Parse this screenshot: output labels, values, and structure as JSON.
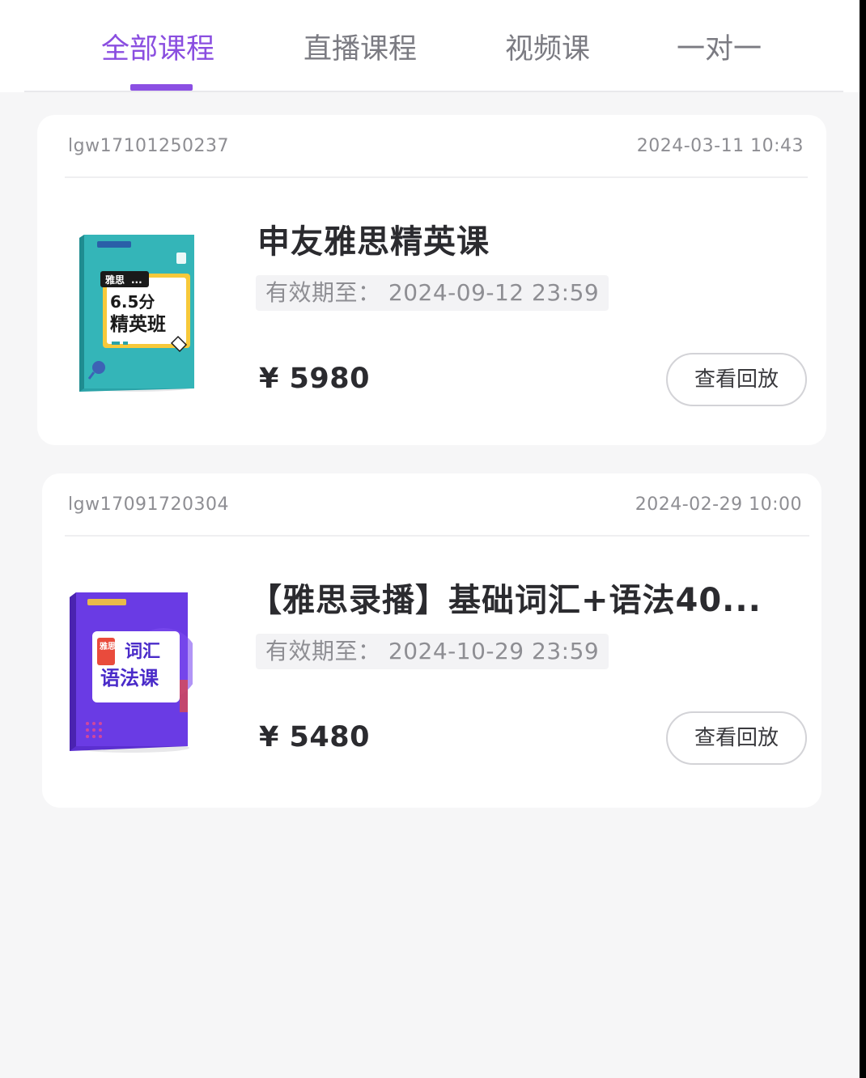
{
  "tabs": [
    {
      "label": "全部课程",
      "active": true
    },
    {
      "label": "直播课程",
      "active": false
    },
    {
      "label": "视频课",
      "active": false
    },
    {
      "label": "一对一",
      "active": false
    }
  ],
  "accent_color": "#8b4fe3",
  "orders": [
    {
      "order_id": "lgw17101250237",
      "order_time": "2024-03-11 10:43",
      "cover": {
        "small_brand": "雅思",
        "line1": "6.5分",
        "line2": "精英班"
      },
      "title": "申友雅思精英课",
      "validity": "有效期至： 2024-09-12 23:59",
      "price": "¥ 5980",
      "button": "查看回放"
    },
    {
      "order_id": "lgw17091720304",
      "order_time": "2024-02-29 10:00",
      "cover": {
        "badge": "雅思",
        "line1": "词汇",
        "line2": "语法课"
      },
      "title": "【雅思录播】基础词汇+语法40...",
      "validity": "有效期至： 2024-10-29 23:59",
      "price": "¥ 5480",
      "button": "查看回放"
    }
  ]
}
